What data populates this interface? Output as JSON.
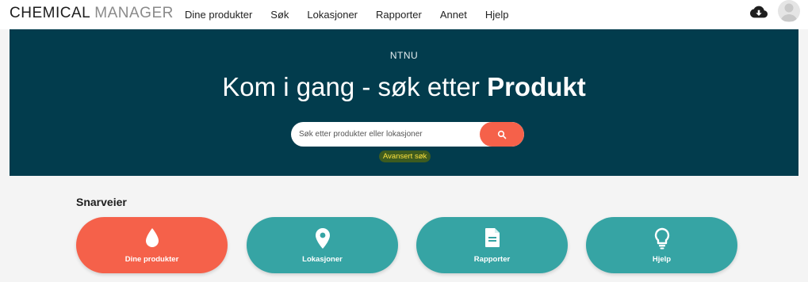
{
  "header": {
    "brand_part1": "CHEMICAL",
    "brand_part2": "MANAGER",
    "nav": [
      {
        "label": "Dine produkter"
      },
      {
        "label": "Søk"
      },
      {
        "label": "Lokasjoner"
      },
      {
        "label": "Rapporter"
      },
      {
        "label": "Annet"
      },
      {
        "label": "Hjelp"
      }
    ],
    "icons": {
      "cloud": "cloud-download-icon",
      "avatar": "user-avatar-icon"
    }
  },
  "hero": {
    "org": "NTNU",
    "headline_light": "Kom i gang - søk etter",
    "headline_bold": "Produkt",
    "search_placeholder": "Søk etter produkter eller lokasjoner",
    "search_icon": "search-icon",
    "advanced_link": "Avansert søk"
  },
  "shortcuts": {
    "title": "Snarveier",
    "items": [
      {
        "label": "Dine produkter",
        "icon": "drop-icon"
      },
      {
        "label": "Lokasjoner",
        "icon": "map-pin-icon"
      },
      {
        "label": "Rapporter",
        "icon": "document-icon"
      },
      {
        "label": "Hjelp",
        "icon": "lightbulb-icon"
      }
    ]
  },
  "colors": {
    "hero_bg": "#023c4d",
    "accent": "#f5614a",
    "teal": "#36a4a4",
    "highlight_bg": "#3d5b1f",
    "highlight_text": "#ffe23d"
  }
}
